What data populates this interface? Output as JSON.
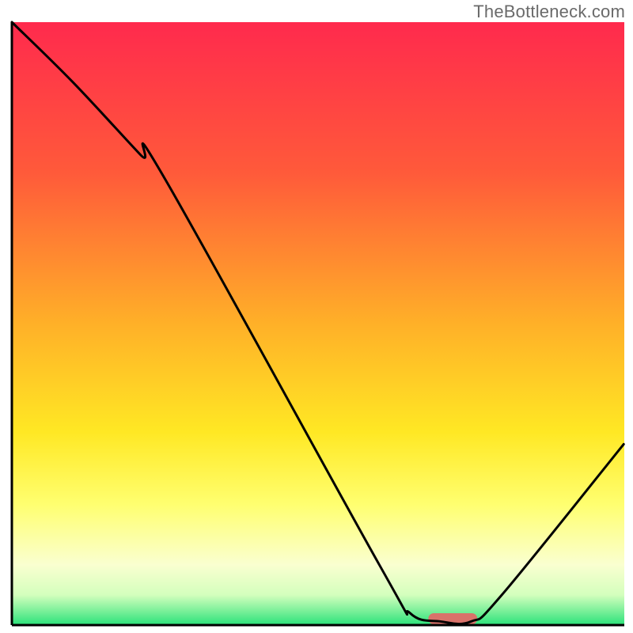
{
  "watermark": "TheBottleneck.com",
  "chart_data": {
    "type": "line",
    "title": "",
    "xlabel": "",
    "ylabel": "",
    "xlim": [
      0,
      100
    ],
    "ylim": [
      0,
      100
    ],
    "grid": false,
    "background_gradient": {
      "stops": [
        {
          "offset": 0,
          "color": "#ff2a4d"
        },
        {
          "offset": 25,
          "color": "#ff5a3a"
        },
        {
          "offset": 50,
          "color": "#ffb028"
        },
        {
          "offset": 68,
          "color": "#ffe824"
        },
        {
          "offset": 80,
          "color": "#ffff70"
        },
        {
          "offset": 90,
          "color": "#faffd0"
        },
        {
          "offset": 95,
          "color": "#d4ffbd"
        },
        {
          "offset": 100,
          "color": "#2be27a"
        }
      ]
    },
    "series": [
      {
        "name": "bottleneck-curve",
        "color": "#000000",
        "x": [
          0.0,
          10.0,
          21.0,
          25.0,
          60.0,
          65.0,
          70.0,
          75.0,
          80.0,
          99.9
        ],
        "y": [
          100.0,
          90.0,
          78.0,
          74.0,
          10.0,
          2.0,
          0.6,
          0.6,
          5.0,
          30.0
        ]
      }
    ],
    "marker": {
      "name": "sweet-spot-marker",
      "x_center": 72,
      "width": 8,
      "color": "#d9726a"
    },
    "axes": {
      "left": {
        "visible": true,
        "color": "#000000"
      },
      "bottom": {
        "visible": true,
        "color": "#000000"
      },
      "right": {
        "visible": false
      },
      "top": {
        "visible": false
      }
    }
  }
}
